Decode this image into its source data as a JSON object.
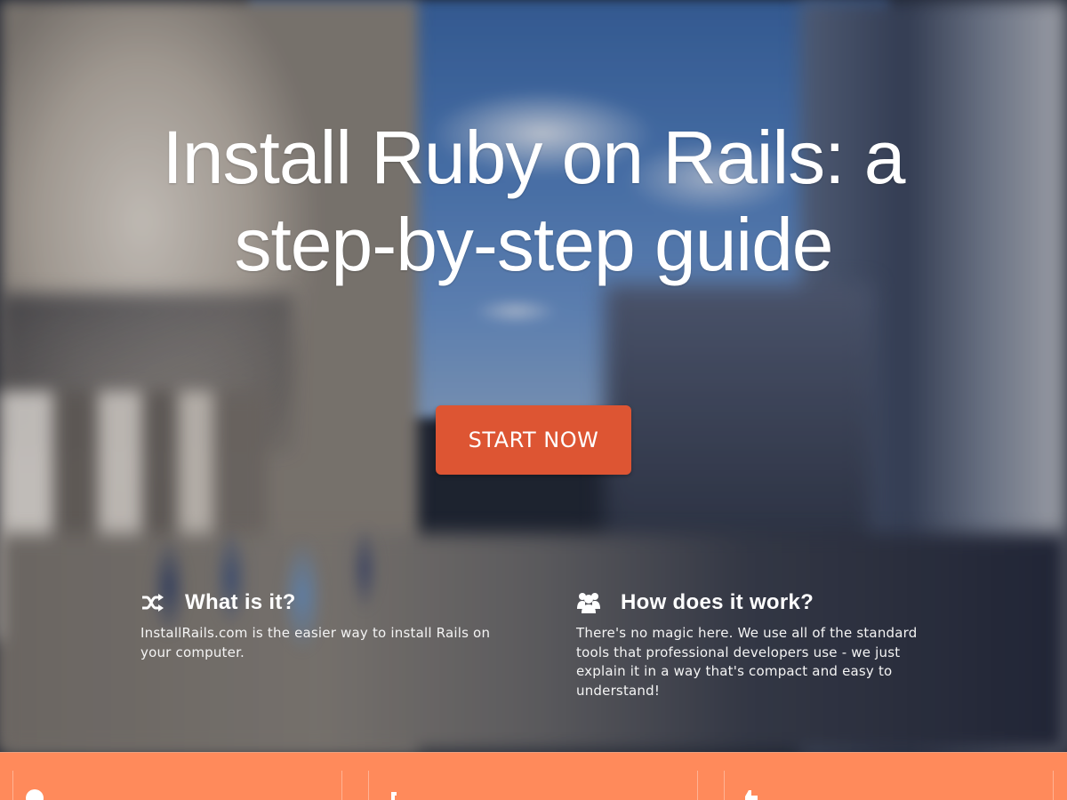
{
  "hero": {
    "title_line1": "Install Ruby on Rails: a",
    "title_line2": "step-by-step guide",
    "cta_label": "START NOW"
  },
  "features": [
    {
      "icon": "shuffle-icon",
      "title": "What is it?",
      "text": "InstallRails.com is the easier way to install Rails on your computer."
    },
    {
      "icon": "users-icon",
      "title": "How does it work?",
      "text": "There's no magic here. We use all of the standard tools that professional developers use - we just explain it in a way that's compact and easy to understand!"
    }
  ],
  "bottom_band": {
    "icons": [
      "globe-icon",
      "wrench-icon",
      "thumbs-up-icon"
    ]
  },
  "colors": {
    "cta": "#dd5533",
    "band": "#ff8a5b",
    "text": "#ffffff"
  }
}
